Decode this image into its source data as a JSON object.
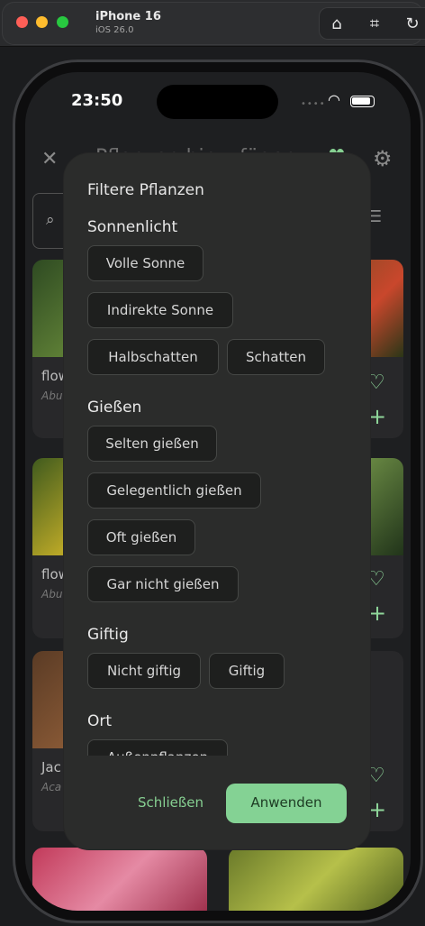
{
  "simulator": {
    "title": "iPhone 16",
    "subtitle": "iOS 26.0",
    "icons": [
      "home-icon",
      "screenshot-icon",
      "rotate-icon"
    ]
  },
  "status": {
    "time": "23:50",
    "icons": [
      "wifi-icon",
      "battery-icon"
    ]
  },
  "background": {
    "header_title": "Pflanzen hinzufügen",
    "cards": [
      {
        "title": "flow",
        "subtitle": "Abu"
      },
      {
        "title": "flow",
        "subtitle": "Abu 'Mo"
      },
      {
        "title": "Jac",
        "subtitle": "Aca wilk"
      }
    ]
  },
  "modal": {
    "title": "Filtere Pflanzen",
    "sections": [
      {
        "label": "Sonnenlicht",
        "chips": [
          "Volle Sonne",
          "Indirekte Sonne",
          "Halbschatten",
          "Schatten"
        ]
      },
      {
        "label": "Gießen",
        "chips": [
          "Selten gießen",
          "Gelegentlich gießen",
          "Oft gießen",
          "Gar nicht gießen"
        ]
      },
      {
        "label": "Giftig",
        "chips": [
          "Nicht giftig",
          "Giftig"
        ]
      },
      {
        "label": "Ort",
        "chips": [
          "Außenpflanzen"
        ]
      }
    ],
    "close_label": "Schließen",
    "apply_label": "Anwenden"
  },
  "colors": {
    "accent": "#84d294",
    "modal_bg": "#2b2c2b",
    "chip_bg": "#1e1f1e"
  }
}
